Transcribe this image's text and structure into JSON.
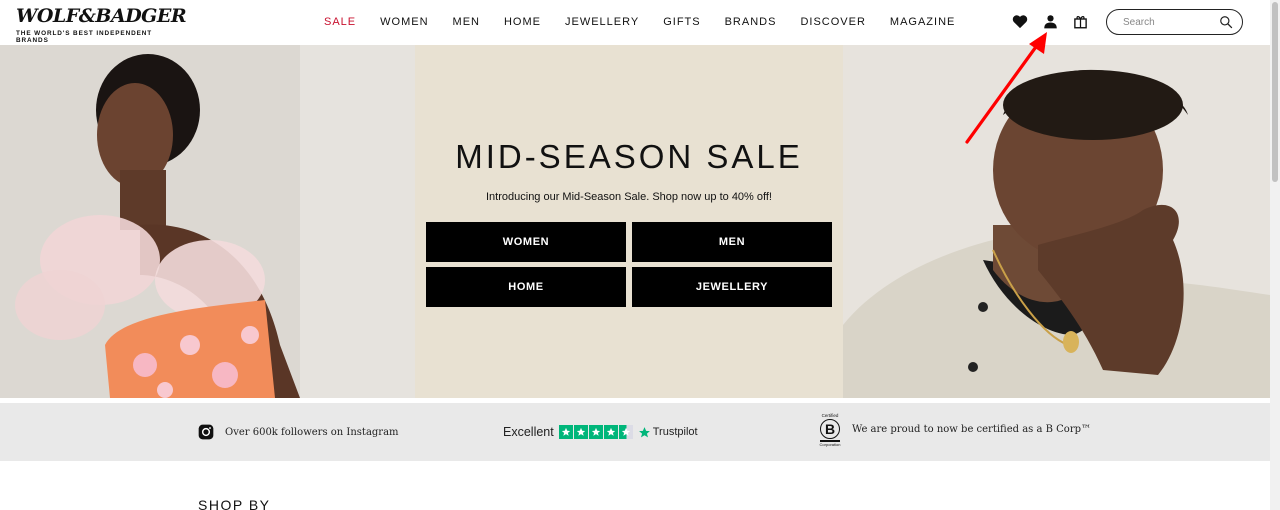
{
  "brand": {
    "logo_text": "WOLF&BADGER",
    "tagline": "THE WORLD'S BEST INDEPENDENT BRANDS"
  },
  "nav": {
    "items": [
      {
        "label": "SALE",
        "highlight": true
      },
      {
        "label": "WOMEN"
      },
      {
        "label": "MEN"
      },
      {
        "label": "HOME"
      },
      {
        "label": "JEWELLERY"
      },
      {
        "label": "GIFTS"
      },
      {
        "label": "BRANDS"
      },
      {
        "label": "DISCOVER"
      },
      {
        "label": "MAGAZINE"
      }
    ]
  },
  "header_icons": {
    "wishlist": "heart-icon",
    "account": "user-icon",
    "bag": "shopping-bag-icon"
  },
  "search": {
    "placeholder": "Search",
    "value": ""
  },
  "hero": {
    "title": "MID-SEASON SALE",
    "subtitle": "Introducing our Mid-Season Sale. Shop now up to 40% off!",
    "buttons": [
      "WOMEN",
      "MEN",
      "HOME",
      "JEWELLERY"
    ]
  },
  "trust_bar": {
    "instagram_text": "Over 600k followers on Instagram",
    "trustpilot_rating_word": "Excellent",
    "trustpilot_brand": "Trustpilot",
    "bcorp_badge_top": "Certified",
    "bcorp_badge_letter": "B",
    "bcorp_badge_bottom": "Corporation",
    "bcorp_text": "We are proud to now be certified as a B Corp™"
  },
  "sections": {
    "shop_by": "SHOP BY"
  },
  "colors": {
    "sale_red": "#c8102e",
    "hero_beige": "#e8e1d2",
    "trustpilot_green": "#00b67a",
    "annotation_arrow": "#ff0000"
  }
}
